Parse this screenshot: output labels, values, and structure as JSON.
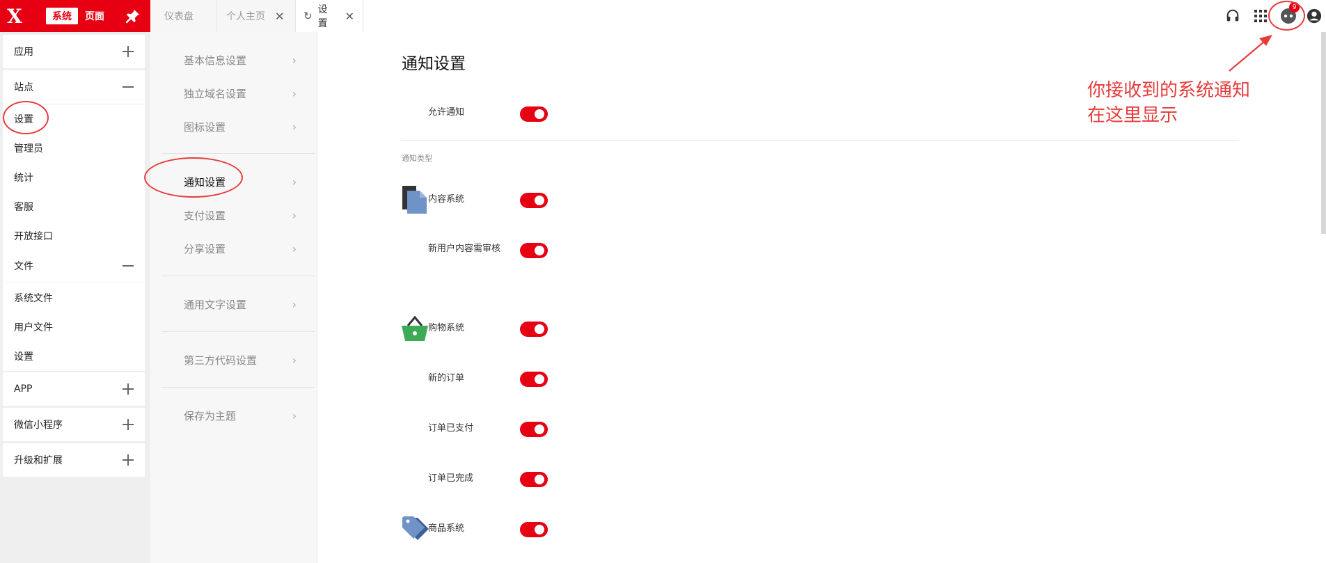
{
  "brand": {
    "logo": "X",
    "mode_active": "系统",
    "mode_other": "页面"
  },
  "sidebar": {
    "groups": [
      {
        "title": "应用",
        "expanded": false
      },
      {
        "title": "站点",
        "expanded": true,
        "items": [
          "设置",
          "管理员",
          "统计",
          "客服",
          "开放接口"
        ]
      },
      {
        "title": "文件",
        "expanded": true,
        "items": [
          "系统文件",
          "用户文件",
          "设置"
        ]
      },
      {
        "title": "APP",
        "expanded": false
      },
      {
        "title": "微信小程序",
        "expanded": false
      },
      {
        "title": "升级和扩展",
        "expanded": false
      }
    ]
  },
  "tabs": [
    {
      "label": "仪表盘"
    },
    {
      "label": "个人主页"
    },
    {
      "label": "设置",
      "active": true
    }
  ],
  "topbar": {
    "notification_count": "9"
  },
  "submenu": {
    "items": [
      "基本信息设置",
      "独立域名设置",
      "图标设置",
      "通知设置",
      "支付设置",
      "分享设置",
      "通用文字设置",
      "第三方代码设置",
      "保存为主题"
    ],
    "active": "通知设置"
  },
  "main": {
    "title": "通知设置",
    "allow_label": "允许通知",
    "types_caption": "通知类型",
    "rows": [
      {
        "label": "内容系统",
        "icon": "content-system-icon"
      },
      {
        "label": "新用户内容需审核"
      },
      {
        "label": "购物系统",
        "icon": "shopping-basket-icon"
      },
      {
        "label": "新的订单"
      },
      {
        "label": "订单已支付"
      },
      {
        "label": "订单已完成"
      },
      {
        "label": "商品系统",
        "icon": "price-tag-icon"
      }
    ]
  },
  "annotation": {
    "line1": "你接收到的系统通知",
    "line2": "在这里显示"
  },
  "colors": {
    "brand_red": "#e60012",
    "annotation_red": "#e63b3b",
    "sidebar_bg": "#efefef",
    "submenu_bg": "#f7f7f7"
  }
}
